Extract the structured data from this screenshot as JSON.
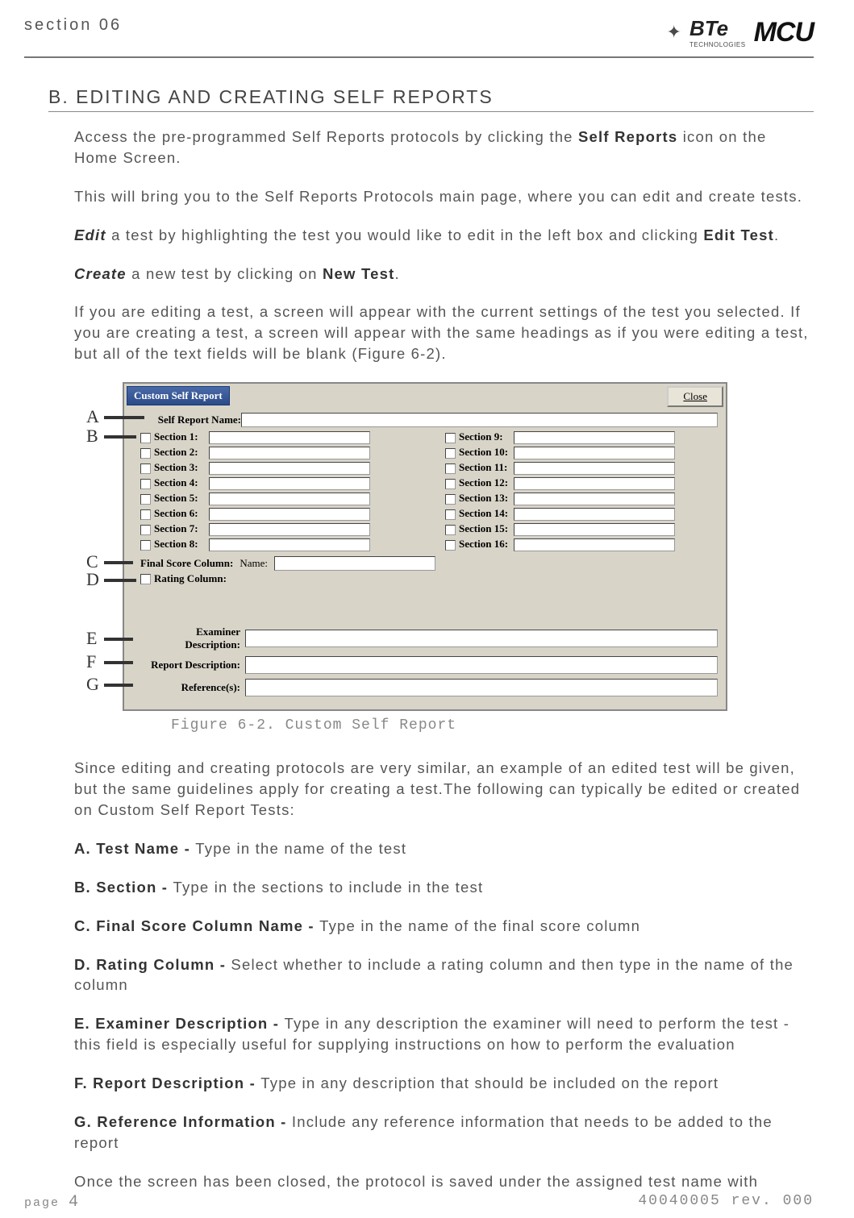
{
  "header": {
    "section_label": "section 06",
    "logo_bte": "BTe",
    "logo_bte_sub": "TECHNOLOGIES",
    "logo_mcu": "MCU"
  },
  "title": "B. EDITING AND CREATING SELF REPORTS",
  "paragraphs": {
    "p1a": "Access the pre-programmed Self Reports protocols by clicking the ",
    "p1b": "Self Reports",
    "p1c": " icon on the Home Screen.",
    "p2": "This will bring you to the Self Reports Protocols main page, where you can edit and create tests.",
    "p3a": "Edit",
    "p3b": " a test by highlighting the test you would like to edit in the left box and clicking ",
    "p3c": "Edit Test",
    "p3d": ".",
    "p4a": "Create",
    "p4b": " a new test by clicking on ",
    "p4c": "New Test",
    "p4d": ".",
    "p5": "If you are editing a test, a screen will appear with the current settings of the test you selected. If you are creating a test, a screen will appear with the same headings as if you were editing a test, but all of the text fields will be blank (Figure 6-2).",
    "p6": "Since editing and creating protocols are very similar, an example of an edited test will be given, but the same guidelines apply for creating a test.The following can typically be edited or created on Custom Self Report Tests:",
    "pA_b": "A. Test Name - ",
    "pA_t": "Type in the name of the test",
    "pB_b": "B. Section - ",
    "pB_t": "Type in the sections to include in the test",
    "pC_b": "C. Final Score Column Name - ",
    "pC_t": "Type in the name of the final score column",
    "pD_b": "D. Rating Column - ",
    "pD_t": "Select whether to include a rating column and then type in the name of the column",
    "pE_b": "E. Examiner Description - ",
    "pE_t": "Type in any description the examiner will need to perform the test - this field is especially useful for supplying instructions on how to perform the evaluation",
    "pF_b": "F. Report Description - ",
    "pF_t": "Type in any description that should be included on the report",
    "pG_b": "G. Reference Information - ",
    "pG_t": "Include any reference information that needs to be added to the report",
    "p_last": "Once the screen has been closed, the protocol is saved under the assigned test name with"
  },
  "figure": {
    "caption": "Figure 6-2. Custom Self Report",
    "callouts": [
      "A",
      "B",
      "C",
      "D",
      "E",
      "F",
      "G"
    ],
    "window": {
      "title": "Custom Self Report",
      "close": "Close",
      "name_label": "Self Report Name:",
      "sections_left": [
        "Section 1:",
        "Section 2:",
        "Section 3:",
        "Section 4:",
        "Section 5:",
        "Section 6:",
        "Section 7:",
        "Section 8:"
      ],
      "sections_right": [
        "Section 9:",
        "Section 10:",
        "Section 11:",
        "Section 12:",
        "Section 13:",
        "Section 14:",
        "Section 15:",
        "Section 16:"
      ],
      "final_score_label": "Final Score Column:",
      "final_score_name_label": "Name:",
      "rating_label": "Rating Column:",
      "examiner_label": "Examiner Description:",
      "report_label": "Report Description:",
      "references_label": "Reference(s):"
    }
  },
  "footer": {
    "page_label": "page",
    "page_num": "4",
    "doc_id": "40040005 rev. 000"
  }
}
